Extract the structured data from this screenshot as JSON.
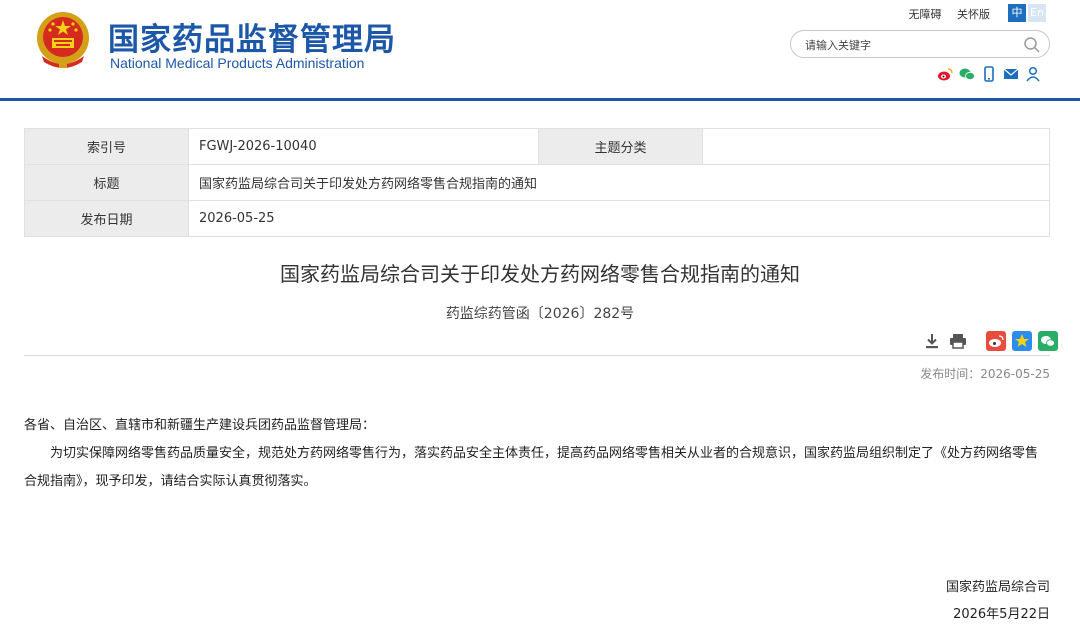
{
  "header": {
    "site_title_cn": "国家药品监督管理局",
    "site_title_en": "National Medical Products Administration",
    "links": [
      "无障碍",
      "关怀版"
    ],
    "lang_zh": "中",
    "lang_en": "En",
    "search_placeholder": "请输入关键字",
    "social_icons": [
      "weibo-icon",
      "wechat-icon",
      "mobile-icon",
      "mail-icon",
      "user-icon"
    ],
    "brand_color": "#1d58a8"
  },
  "info_table": {
    "index_label": "索引号",
    "index_value": "FGWJ-2026-10040",
    "topic_label": "主题分类",
    "topic_value": "",
    "title_label": "标题",
    "title_value": "国家药监局综合司关于印发处方药网络零售合规指南的通知",
    "date_label": "发布日期",
    "date_value": "2026-05-25"
  },
  "article": {
    "title": "国家药监局综合司关于印发处方药网络零售合规指南的通知",
    "doc_number": "药监综药管函〔2026〕282号",
    "tools": [
      "download-icon",
      "print-icon",
      "share-weibo-icon",
      "share-qzone-icon",
      "share-wechat-icon"
    ],
    "publish_time": "发布时间：2026-05-25",
    "salutation": "各省、自治区、直辖市和新疆生产建设兵团药品监督管理局：",
    "paragraph": "为切实保障网络零售药品质量安全，规范处方药网络零售行为，落实药品安全主体责任，提高药品网络零售相关从业者的合规意识，国家药监局组织制定了《处方药网络零售合规指南》，现予印发，请结合实际认真贯彻落实。",
    "signature_org": "国家药监局综合司",
    "signature_date": "2026年5月22日"
  }
}
